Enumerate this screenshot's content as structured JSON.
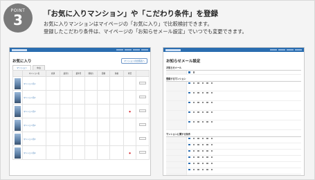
{
  "point": {
    "label": "POINT",
    "number": "3"
  },
  "header": {
    "title": "「お気に入りマンション」や「こだわり条件」を登録",
    "desc_line1": "お気に入りマンションはマイページの「お気に入り」で比較検討できます。",
    "desc_line2": "登録したこだわり条件は、マイページの「お知らせメール設定」でいつでも変更できます。"
  },
  "favorites": {
    "title": "お気に入り",
    "action_button": "マンションの比較表へ",
    "tabs": [
      "マンション",
      "中古"
    ],
    "columns": [
      "",
      "マンション名",
      "交通",
      "最寄り",
      "築年月",
      "間取り",
      "面積",
      "価格",
      "状況",
      ""
    ],
    "rows": [
      {
        "name": "マンション名1",
        "price": "",
        "is_new": false
      },
      {
        "name": "マンション名2",
        "price": "",
        "is_new": false
      },
      {
        "name": "マンション名3",
        "price": "",
        "is_new": true
      },
      {
        "name": "マンション名4",
        "price": "",
        "is_new": false
      },
      {
        "name": "マンション名5",
        "price": "",
        "is_new": false
      },
      {
        "name": "マンション名6",
        "price": "",
        "is_new": true
      }
    ]
  },
  "mail_settings": {
    "title": "お知らせメール設定",
    "section1": "お知らせメール",
    "section2": "登録するマンション",
    "section3": "マンションに関する条件",
    "rows_area": [
      "",
      "",
      "",
      "",
      ""
    ],
    "rows_cond": [
      "",
      "",
      "",
      "",
      "",
      "",
      ""
    ]
  },
  "colors": {
    "accent": "#2a6db0",
    "badge": "#7a7a7a",
    "new": "#d2232a"
  }
}
